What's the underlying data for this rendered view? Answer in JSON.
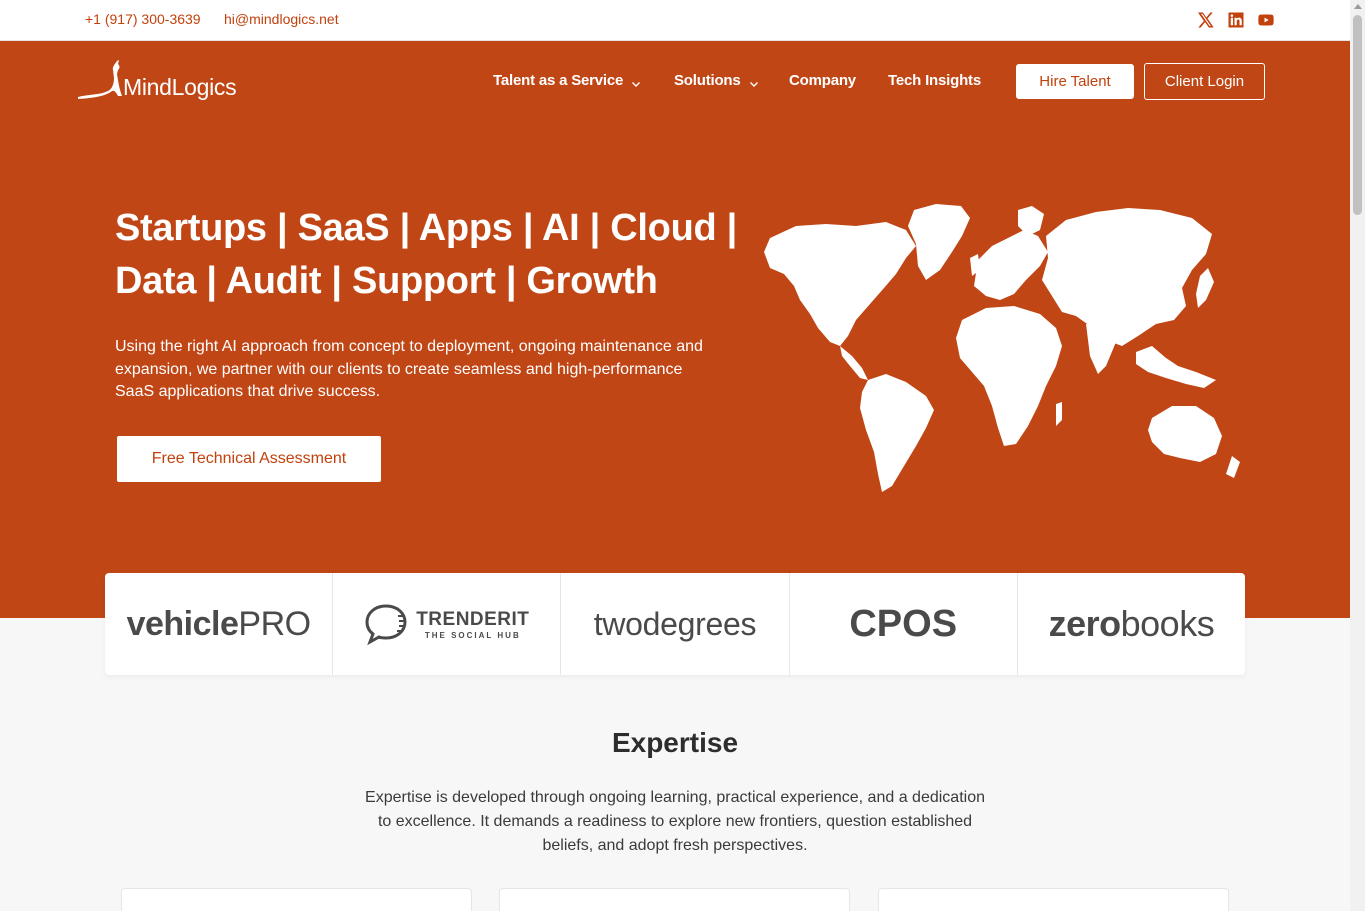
{
  "topbar": {
    "phone": "+1 (917) 300-3639",
    "email": "hi@mindlogics.net",
    "social": [
      "x-icon",
      "linkedin-icon",
      "youtube-icon"
    ]
  },
  "brand": {
    "name": "MindLogics",
    "icon": "kangaroo-logo"
  },
  "nav": {
    "items": [
      {
        "label": "Talent as a Service",
        "dropdown": true
      },
      {
        "label": "Solutions",
        "dropdown": true
      },
      {
        "label": "Company",
        "dropdown": false
      },
      {
        "label": "Tech Insights",
        "dropdown": false
      }
    ],
    "hire_label": "Hire Talent",
    "login_label": "Client Login"
  },
  "hero": {
    "title_line1": "Startups | SaaS | Apps | AI | Cloud |",
    "title_line2": "Data | Audit | Support | Growth",
    "description": "Using the right AI approach from concept to deployment, ongoing maintenance and expansion, we partner with our clients to create seamless and high-performance SaaS applications that drive success.",
    "cta_label": "Free Technical Assessment"
  },
  "clients": {
    "vehicle_a": "vehicle",
    "vehicle_b": "PRO",
    "trenderit_a": "TRENDERIT",
    "trenderit_b": "THE SOCIAL HUB",
    "twodegrees": "twodegrees",
    "cpos": "CPOS",
    "zero_a": "zero",
    "zero_b": "books"
  },
  "expertise": {
    "title": "Expertise",
    "description": "Expertise is developed through ongoing learning, practical experience, and a dedication to excellence. It demands a readiness to explore new frontiers, question established beliefs, and adopt fresh perspectives."
  },
  "colors": {
    "brand": "#c14615",
    "accent_text": "#c2410c",
    "background": "#f7f7f7"
  }
}
